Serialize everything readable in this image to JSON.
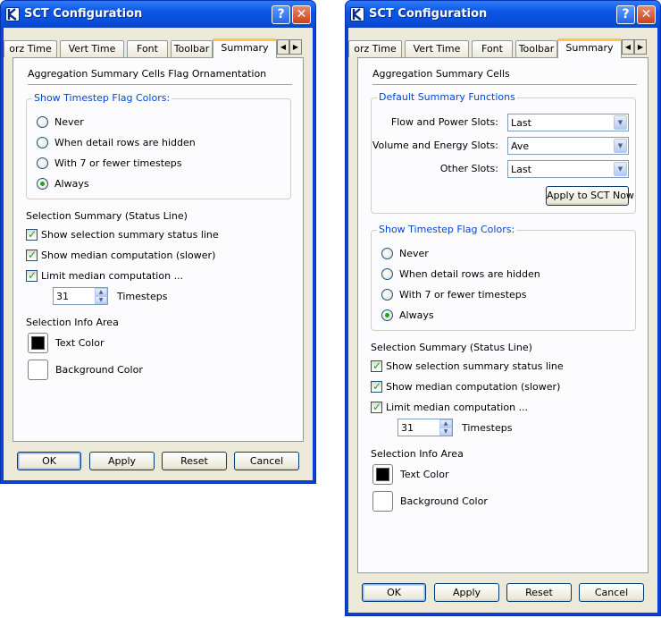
{
  "left_window": {
    "title": "SCT Configuration",
    "help_glyph": "?",
    "close_glyph": "✕",
    "tabs": [
      "orz Time",
      "Vert Time",
      "Font",
      "Toolbar",
      "Summary"
    ],
    "active_tab": "Summary",
    "heading": "Aggregation Summary Cells Flag Ornamentation",
    "flag_group": {
      "caption": "Show Timestep Flag Colors:",
      "options": [
        "Never",
        "When detail rows are hidden",
        "With 7 or fewer timesteps",
        "Always"
      ],
      "selected": "Always"
    },
    "selection_summary": {
      "heading": "Selection Summary (Status Line)",
      "checks": [
        {
          "label": "Show selection summary status line",
          "checked": true
        },
        {
          "label": "Show median computation (slower)",
          "checked": true
        },
        {
          "label": "Limit median computation ...",
          "checked": true
        }
      ],
      "timesteps_value": "31",
      "timesteps_label": "Timesteps"
    },
    "info_area": {
      "heading": "Selection Info Area",
      "text_color_label": "Text Color",
      "background_color_label": "Background Color",
      "text_color": "#000000",
      "background_color": "#ffffff"
    },
    "buttons": {
      "ok": "OK",
      "apply": "Apply",
      "reset": "Reset",
      "cancel": "Cancel"
    }
  },
  "right_window": {
    "title": "SCT Configuration",
    "help_glyph": "?",
    "close_glyph": "✕",
    "tabs": [
      "orz Time",
      "Vert Time",
      "Font",
      "Toolbar",
      "Summary"
    ],
    "active_tab": "Summary",
    "heading": "Aggregation Summary Cells",
    "default_functions": {
      "caption": "Default Summary Functions",
      "rows": [
        {
          "label": "Flow and Power Slots:",
          "value": "Last"
        },
        {
          "label": "Volume and Energy Slots:",
          "value": "Ave"
        },
        {
          "label": "Other Slots:",
          "value": "Last"
        }
      ],
      "apply_label": "Apply to SCT Now"
    },
    "flag_group": {
      "caption": "Show Timestep Flag Colors:",
      "options": [
        "Never",
        "When detail rows are hidden",
        "With 7 or fewer timesteps",
        "Always"
      ],
      "selected": "Always"
    },
    "selection_summary": {
      "heading": "Selection Summary (Status Line)",
      "checks": [
        {
          "label": "Show selection summary status line",
          "checked": true
        },
        {
          "label": "Show median computation (slower)",
          "checked": true
        },
        {
          "label": "Limit median computation ...",
          "checked": true
        }
      ],
      "timesteps_value": "31",
      "timesteps_label": "Timesteps"
    },
    "info_area": {
      "heading": "Selection Info Area",
      "text_color_label": "Text Color",
      "background_color_label": "Background Color",
      "text_color": "#000000",
      "background_color": "#ffffff"
    },
    "buttons": {
      "ok": "OK",
      "apply": "Apply",
      "reset": "Reset",
      "cancel": "Cancel"
    }
  },
  "icons": {
    "tab_scroll_left": "◀",
    "tab_scroll_right": "▶",
    "dropdown": "▼",
    "spin_up": "▲",
    "spin_down": "▼",
    "check": "✓"
  }
}
